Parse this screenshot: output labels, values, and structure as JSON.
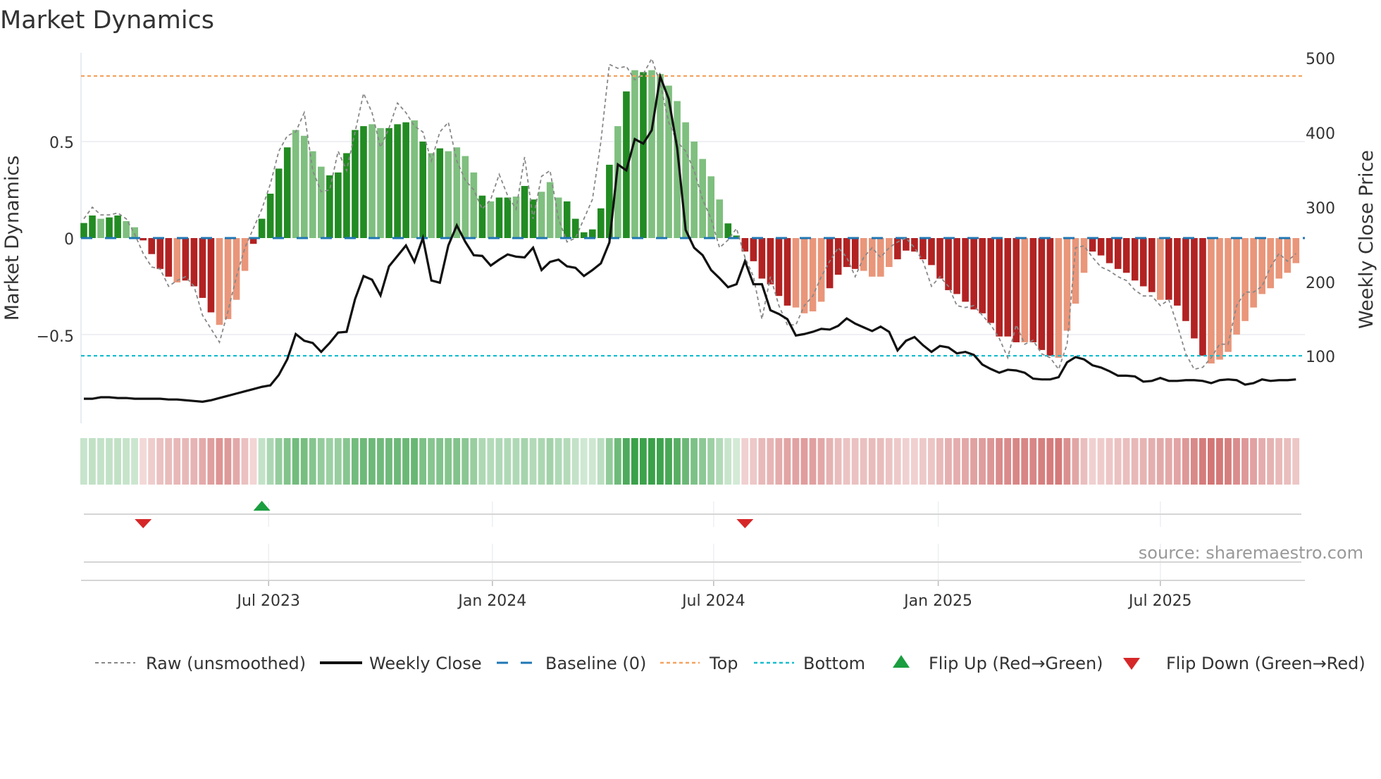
{
  "chart_data": {
    "type": "bar",
    "title": "Market Dynamics",
    "ylabel": "Market Dynamics",
    "y2label": "Weekly Close Price",
    "ylim": [
      -0.96,
      0.96
    ],
    "y2lim": [
      10,
      508
    ],
    "y_ticks": [
      "0.5",
      "0",
      "−0.5"
    ],
    "y_tick_values": [
      0.5,
      0,
      -0.5
    ],
    "y2_ticks": [
      "500",
      "400",
      "300",
      "200",
      "100"
    ],
    "y2_tick_values": [
      500,
      400,
      300,
      200,
      100
    ],
    "x_ticks": [
      {
        "label": "Jul 2023",
        "at_week": 21.8
      },
      {
        "label": "Jan 2024",
        "at_week": 48.2
      },
      {
        "label": "Jul 2024",
        "at_week": 74.3
      },
      {
        "label": "Jan 2025",
        "at_week": 100.8
      },
      {
        "label": "Jul 2025",
        "at_week": 127.0
      }
    ],
    "top_level": 0.84,
    "bottom_level": -0.61,
    "baseline": 0,
    "colors": {
      "pos_strong": "#228b22",
      "pos_weak": "#7fbf7f",
      "neg_strong": "#b22222",
      "neg_weak": "#e9967a",
      "raw": "#888888",
      "close": "#111111",
      "baseline": "#1f77b4",
      "top": "#f4a460",
      "bottom": "#17becf",
      "flip_up": "#1a9e3f",
      "flip_down": "#d62728"
    },
    "series": [
      {
        "name": "Market Dynamics (smoothed)",
        "values": [
          0.078,
          0.117,
          0.1,
          0.107,
          0.117,
          0.088,
          0.056,
          -0.012,
          -0.083,
          -0.16,
          -0.2,
          -0.23,
          -0.22,
          -0.25,
          -0.31,
          -0.385,
          -0.45,
          -0.42,
          -0.32,
          -0.17,
          -0.03,
          0.1,
          0.23,
          0.36,
          0.47,
          0.56,
          0.53,
          0.45,
          0.37,
          0.325,
          0.34,
          0.44,
          0.56,
          0.58,
          0.59,
          0.57,
          0.57,
          0.59,
          0.6,
          0.61,
          0.5,
          0.44,
          0.465,
          0.45,
          0.47,
          0.425,
          0.34,
          0.22,
          0.19,
          0.21,
          0.21,
          0.215,
          0.27,
          0.2,
          0.24,
          0.29,
          0.21,
          0.19,
          0.1,
          0.03,
          0.045,
          0.154,
          0.38,
          0.58,
          0.76,
          0.87,
          0.86,
          0.87,
          0.85,
          0.79,
          0.71,
          0.6,
          0.5,
          0.41,
          0.32,
          0.2,
          0.076,
          0.013,
          -0.07,
          -0.12,
          -0.21,
          -0.24,
          -0.3,
          -0.35,
          -0.36,
          -0.39,
          -0.38,
          -0.33,
          -0.26,
          -0.19,
          -0.15,
          -0.16,
          -0.17,
          -0.2,
          -0.2,
          -0.15,
          -0.11,
          -0.065,
          -0.07,
          -0.11,
          -0.14,
          -0.21,
          -0.27,
          -0.29,
          -0.33,
          -0.37,
          -0.39,
          -0.44,
          -0.51,
          -0.51,
          -0.54,
          -0.54,
          -0.54,
          -0.58,
          -0.61,
          -0.62,
          -0.48,
          -0.34,
          -0.18,
          -0.07,
          -0.09,
          -0.13,
          -0.16,
          -0.18,
          -0.22,
          -0.25,
          -0.28,
          -0.32,
          -0.32,
          -0.35,
          -0.43,
          -0.52,
          -0.61,
          -0.65,
          -0.63,
          -0.59,
          -0.5,
          -0.43,
          -0.36,
          -0.29,
          -0.26,
          -0.21,
          -0.18,
          -0.13
        ],
        "strong": "1101100111101111000011111000011111001110101000010110110001111110101000000000111111110000111100001111111111111110111000011111111011111000000000"
      },
      {
        "name": "Raw (unsmoothed)",
        "values": [
          0.1,
          0.16,
          0.12,
          0.12,
          0.13,
          0.1,
          0.02,
          -0.08,
          -0.15,
          -0.16,
          -0.25,
          -0.22,
          -0.2,
          -0.25,
          -0.4,
          -0.47,
          -0.54,
          -0.38,
          -0.2,
          -0.05,
          0.05,
          0.15,
          0.28,
          0.45,
          0.53,
          0.55,
          0.65,
          0.35,
          0.24,
          0.25,
          0.45,
          0.35,
          0.55,
          0.75,
          0.65,
          0.47,
          0.57,
          0.7,
          0.65,
          0.58,
          0.55,
          0.4,
          0.55,
          0.6,
          0.4,
          0.3,
          0.25,
          0.15,
          0.2,
          0.33,
          0.22,
          0.15,
          0.42,
          0.1,
          0.32,
          0.35,
          0.1,
          -0.02,
          0.0,
          0.1,
          0.2,
          0.5,
          0.9,
          0.88,
          0.89,
          0.82,
          0.85,
          0.93,
          0.8,
          0.6,
          0.5,
          0.45,
          0.35,
          0.2,
          0.1,
          -0.05,
          -0.01,
          0.05,
          -0.1,
          -0.2,
          -0.42,
          -0.2,
          -0.35,
          -0.45,
          -0.45,
          -0.35,
          -0.3,
          -0.2,
          -0.12,
          -0.05,
          -0.1,
          -0.2,
          -0.1,
          -0.05,
          -0.1,
          -0.05,
          -0.02,
          0,
          -0.05,
          -0.12,
          -0.25,
          -0.2,
          -0.25,
          -0.35,
          -0.36,
          -0.35,
          -0.4,
          -0.45,
          -0.52,
          -0.62,
          -0.45,
          -0.55,
          -0.53,
          -0.6,
          -0.62,
          -0.68,
          -0.55,
          -0.05,
          -0.04,
          -0.1,
          -0.15,
          -0.17,
          -0.2,
          -0.22,
          -0.27,
          -0.3,
          -0.3,
          -0.35,
          -0.32,
          -0.45,
          -0.6,
          -0.68,
          -0.67,
          -0.62,
          -0.55,
          -0.55,
          -0.35,
          -0.28,
          -0.28,
          -0.25,
          -0.15,
          -0.08,
          -0.12,
          -0.08
        ]
      },
      {
        "name": "Weekly Close",
        "axis": "right",
        "values": [
          43,
          43,
          45,
          45,
          44,
          44,
          43,
          43,
          43,
          43,
          42,
          42,
          41,
          40,
          39,
          41,
          44,
          47,
          50,
          53,
          56,
          59,
          61,
          75,
          96,
          130,
          121,
          118,
          106,
          118,
          132,
          133,
          177,
          208,
          203,
          182,
          221,
          235,
          249,
          227,
          259,
          202,
          199,
          249,
          276,
          254,
          236,
          235,
          222,
          230,
          237,
          234,
          233,
          246,
          216,
          227,
          230,
          221,
          219,
          208,
          216,
          225,
          253,
          358,
          350,
          392,
          386,
          404,
          476,
          446,
          380,
          270,
          246,
          236,
          216,
          205,
          193,
          197,
          228,
          197,
          197,
          162,
          157,
          150,
          128,
          130,
          133,
          137,
          136,
          141,
          151,
          144,
          139,
          134,
          140,
          133,
          108,
          121,
          126,
          115,
          106,
          114,
          112,
          104,
          106,
          102,
          89,
          83,
          78,
          82,
          81,
          78,
          70,
          69,
          69,
          72,
          92,
          99,
          96,
          88,
          85,
          80,
          74,
          74,
          73,
          66,
          67,
          71,
          67,
          67,
          68,
          68,
          67,
          64,
          68,
          69,
          68,
          62,
          64,
          69,
          67,
          68,
          68,
          69
        ]
      }
    ],
    "flips": [
      {
        "week": 7,
        "type": "down"
      },
      {
        "week": 21,
        "type": "up"
      },
      {
        "week": 78,
        "type": "down"
      }
    ],
    "legend": {
      "placement": "bottom",
      "items": [
        "Raw (unsmoothed)",
        "Weekly Close",
        "Baseline (0)",
        "Top",
        "Bottom",
        "Flip Up (Red→Green)",
        "Flip Down (Green→Red)"
      ]
    },
    "source": "source: sharemaestro.com"
  }
}
